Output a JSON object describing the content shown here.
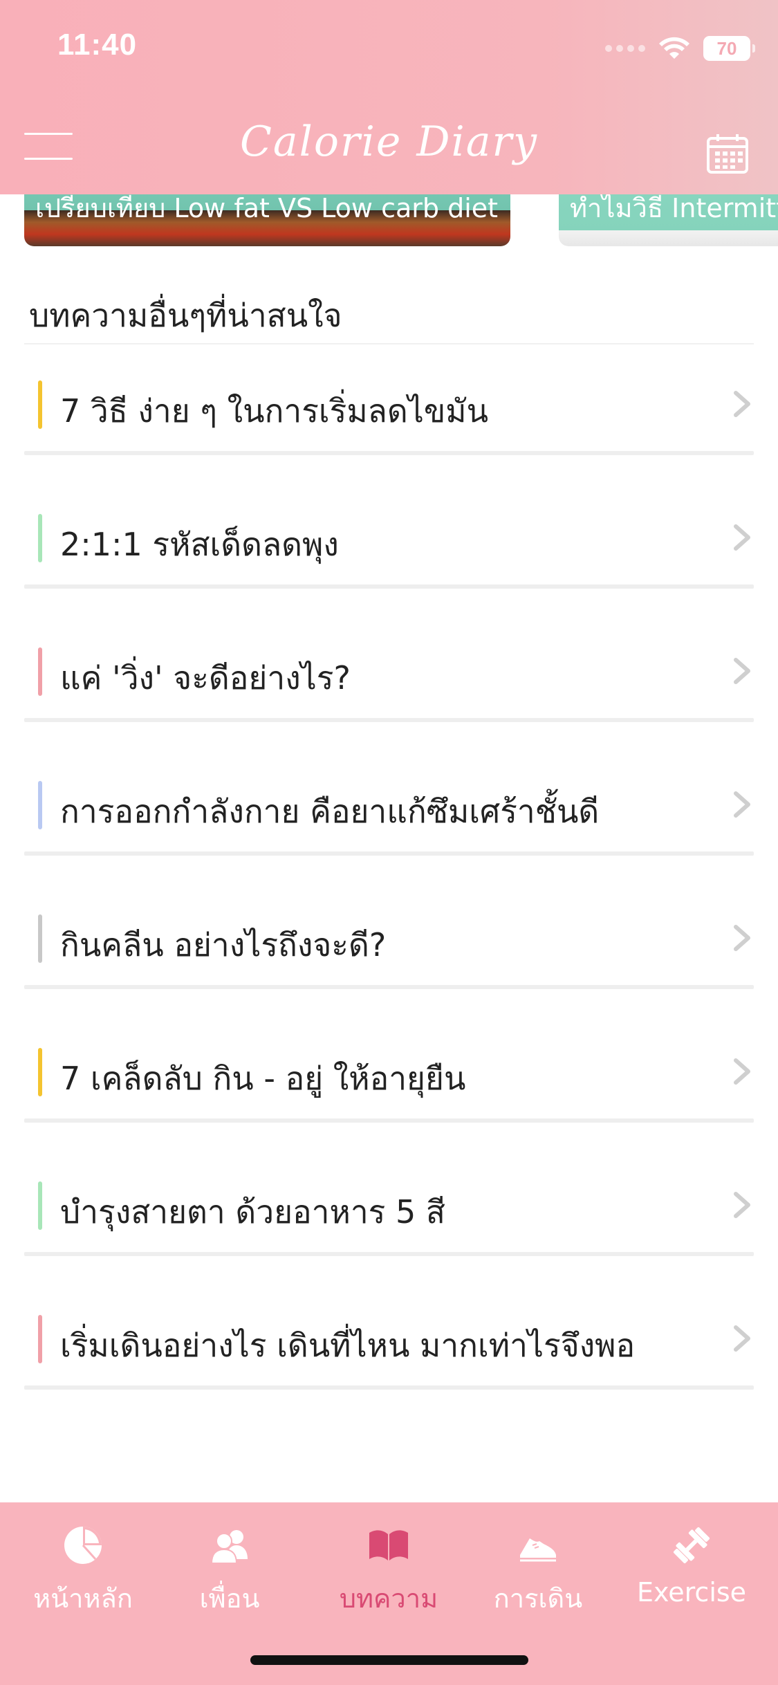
{
  "status_bar": {
    "time": "11:40",
    "battery": "70"
  },
  "header": {
    "logo_text": "Calorie Diary"
  },
  "carousel": [
    {
      "title": "เปรียบเทียบ Low fat VS Low carb diet"
    },
    {
      "title": "ทำไมวิธี Intermittent"
    }
  ],
  "section": {
    "title": "บทความอื่นๆที่น่าสนใจ"
  },
  "articles": [
    {
      "title": "7 วิธี ง่าย ๆ ในการเริ่มลดไขมัน",
      "accent": "#f4c430"
    },
    {
      "title": "2:1:1 รหัสเด็ดลดพุง",
      "accent": "#a8e6b8"
    },
    {
      "title": "แค่ 'วิ่ง' จะดีอย่างไร?",
      "accent": "#f0a0a8"
    },
    {
      "title": "การออกกำลังกาย คือยาแก้ซึมเศร้าชั้นดี",
      "accent": "#b9c9f2"
    },
    {
      "title": "กินคลีน อย่างไรถึงจะดี?",
      "accent": "#c8c8c8"
    },
    {
      "title": "7 เคล็ดลับ กิน - อยู่ ให้อายุยืน",
      "accent": "#f4c430"
    },
    {
      "title": "บำรุงสายตา ด้วยอาหาร 5 สี",
      "accent": "#a8e6b8"
    },
    {
      "title": "เริ่มเดินอย่างไร เดินที่ไหน มากเท่าไรจึงพอ",
      "accent": "#f0a0a8"
    }
  ],
  "tabs": [
    {
      "label": "หน้าหลัก",
      "icon": "pie-chart-icon"
    },
    {
      "label": "เพื่อน",
      "icon": "friends-icon"
    },
    {
      "label": "บทความ",
      "icon": "book-icon",
      "active": true
    },
    {
      "label": "การเดิน",
      "icon": "shoe-icon"
    },
    {
      "label": "Exercise",
      "icon": "dumbbell-icon"
    }
  ],
  "colors": {
    "header_pink": "#f9b0b9",
    "tabbar_pink": "#f9b4bd",
    "active_tab": "#d94a73"
  }
}
